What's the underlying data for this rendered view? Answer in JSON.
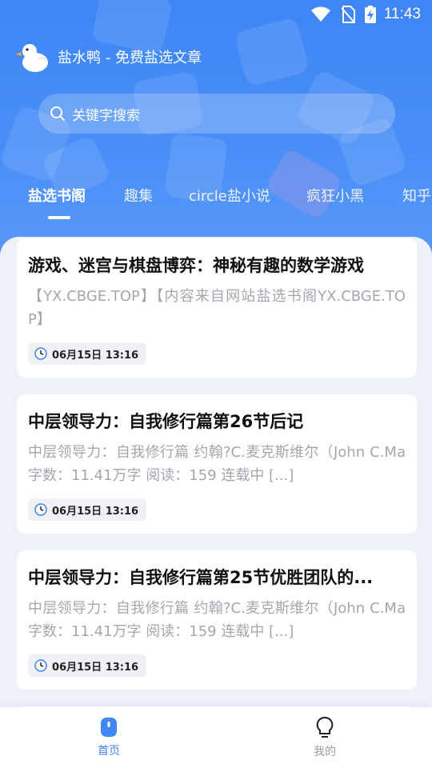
{
  "status_bar": {
    "time": "11:43"
  },
  "app": {
    "title": "盐水鸭 - 免费盐选文章"
  },
  "search": {
    "placeholder": "关键字搜索"
  },
  "tabs": [
    {
      "label": "盐选书阁"
    },
    {
      "label": "趣集"
    },
    {
      "label": "circle盐小说"
    },
    {
      "label": "疯狂小黑"
    },
    {
      "label": "知乎"
    }
  ],
  "articles": [
    {
      "title": "游戏、迷宫与棋盘博弈：神秘有趣的数学游戏",
      "desc": "【YX.CBGE.TOP】【内容来自网站盐选书阁YX.CBGE.TOP】",
      "date": "06月15日 13:16"
    },
    {
      "title": "中层领导力：自我修行篇第26节后记",
      "desc": "中层领导力：自我修行篇 约翰?C.麦克斯维尔（John C.Ma 字数：11.41万字 阅读：159 连载中 [...]",
      "date": "06月15日 13:16"
    },
    {
      "title": "中层领导力：自我修行篇第25节优胜团队的...",
      "desc": "中层领导力：自我修行篇 约翰?C.麦克斯维尔（John C.Ma 字数：11.41万字 阅读：159 连载中 [...]",
      "date": "06月15日 13:16"
    }
  ],
  "bottom_nav": {
    "home": "首页",
    "mine": "我的"
  },
  "colors": {
    "accent": "#3f86f6",
    "nav_inactive": "#9a9ea6"
  }
}
